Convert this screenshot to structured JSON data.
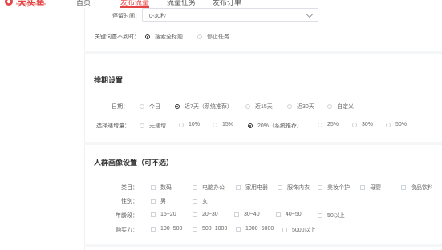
{
  "header": {
    "logo_text": "大头鱼",
    "logo_url": "http://jingshoudao.cn",
    "nav": [
      "首页",
      "发布流量",
      "流量任务",
      "发布订单"
    ],
    "active_nav_index": 1
  },
  "stay_time": {
    "label": "停留时间：",
    "value": "0-30秒"
  },
  "keyword_not_found": {
    "label": "关键词查不到时：",
    "options": [
      "搜索全标题",
      "停止任务"
    ],
    "selected_index": 0
  },
  "schedule": {
    "title": "排期设置",
    "date": {
      "label": "日期：",
      "options": [
        "今日",
        "近7天（系统推荐）",
        "近15天",
        "近30天",
        "自定义"
      ],
      "selected_index": 1
    },
    "increment": {
      "label": "选择递增量：",
      "options": [
        "无递增",
        "10%",
        "15%",
        "20%（系统推荐）",
        "25%",
        "30%",
        "50%"
      ],
      "selected_index": 3
    }
  },
  "persona": {
    "title": "人群画像设置（可不选）",
    "category": {
      "label": "类目：",
      "options": [
        "数码",
        "电脑办公",
        "家用电器",
        "服饰内衣",
        "美妆个护",
        "母婴",
        "食品饮料"
      ]
    },
    "gender": {
      "label": "性别：",
      "options": [
        "男",
        "女"
      ]
    },
    "age": {
      "label": "年龄段：",
      "options": [
        "15~20",
        "20~30",
        "30~40",
        "40~50",
        "50以上"
      ]
    },
    "purchasing_power": {
      "label": "购买力：",
      "options": [
        "100~500",
        "500~1000",
        "1000~5000",
        "5000以上"
      ]
    }
  },
  "colors": {
    "brand": "#e64545",
    "text": "#333333",
    "muted": "#666666",
    "border": "#dcdfe6"
  }
}
